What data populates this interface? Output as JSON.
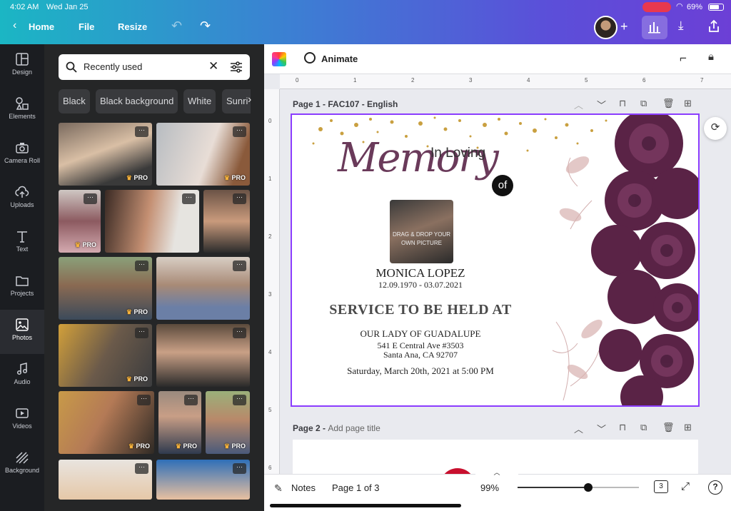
{
  "status": {
    "time": "4:02 AM",
    "date": "Wed Jan 25",
    "battery": "69%"
  },
  "topbar": {
    "home": "Home",
    "file": "File",
    "resize": "Resize"
  },
  "rail": [
    {
      "label": "Design",
      "icon": "layout-icon"
    },
    {
      "label": "Elements",
      "icon": "shapes-icon"
    },
    {
      "label": "Camera Roll",
      "icon": "camera-icon"
    },
    {
      "label": "Uploads",
      "icon": "upload-cloud-icon"
    },
    {
      "label": "Text",
      "icon": "text-icon"
    },
    {
      "label": "Projects",
      "icon": "folder-icon"
    },
    {
      "label": "Photos",
      "icon": "image-icon"
    },
    {
      "label": "Audio",
      "icon": "music-note-icon"
    },
    {
      "label": "Videos",
      "icon": "video-icon"
    },
    {
      "label": "Background",
      "icon": "pattern-icon"
    }
  ],
  "search": {
    "value": "Recently used"
  },
  "chips": [
    "Black",
    "Black background",
    "White",
    "Sunri"
  ],
  "pro_label": "PRO",
  "toolbar": {
    "animate": "Animate"
  },
  "ruler": {
    "h": [
      "0",
      "1",
      "2",
      "3",
      "4",
      "5",
      "6",
      "7"
    ],
    "v": [
      "0",
      "1",
      "2",
      "3",
      "4",
      "5",
      "6"
    ]
  },
  "page1": {
    "label": "Page 1 - FAC107 - English"
  },
  "page2": {
    "label": "Page 2 - ",
    "placeholder": "Add page title"
  },
  "design": {
    "in_loving": "In Loving",
    "memory": "Memory",
    "of": "of",
    "photo_hint": "DRAG & DROP YOUR OWN PICTURE",
    "name": "MONICA LOPEZ",
    "dates": "12.09.1970 - 03.07.2021",
    "service": "SERVICE TO BE HELD AT",
    "venue": "OUR LADY OF GUADALUPE",
    "address1": "541 E Central Ave #3503",
    "address2": "Santa Ana, CA 92707",
    "datetime": "Saturday, March 20th, 2021 at 5:00 PM"
  },
  "bottom": {
    "notes": "Notes",
    "page": "Page 1 of 3",
    "zoom": "99%",
    "zoom_level": 0.58,
    "pages_count": "3",
    "help": "?"
  },
  "colors": {
    "accent": "#8b3dff",
    "plum": "#5a2346",
    "gold": "#c9a040"
  }
}
